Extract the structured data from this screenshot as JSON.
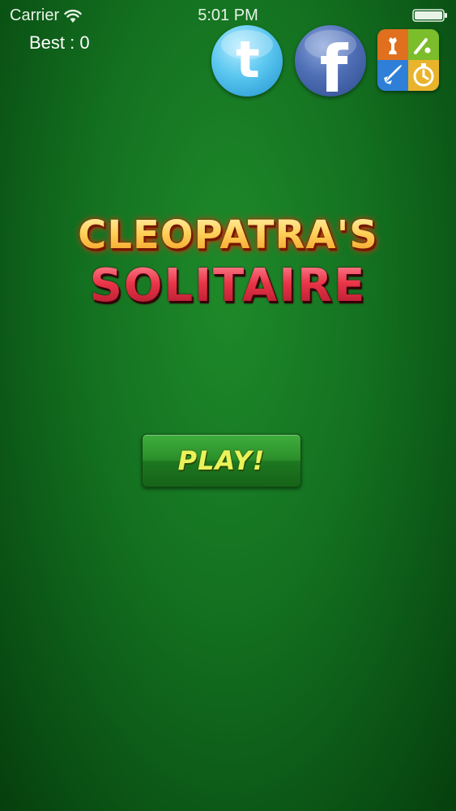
{
  "status_bar": {
    "carrier": "Carrier",
    "time": "5:01 PM"
  },
  "score": {
    "best_label": "Best : 0"
  },
  "social": {
    "twitter_glyph": "t",
    "facebook_glyph": "f"
  },
  "title": {
    "line1": "CLEOPATRA'S",
    "line2": "SOLITAIRE"
  },
  "play_button": {
    "label": "PLAY!"
  },
  "icons": {
    "wifi": "wifi-icon",
    "battery": "battery-icon",
    "twitter": "twitter-icon",
    "facebook": "facebook-icon",
    "game_center": "game-center-icon"
  },
  "colors": {
    "background": "#137020",
    "title_gold": "#ffc74f",
    "title_red": "#e8354a",
    "play_text": "#e9f25a",
    "play_button": "#2b8f2a"
  }
}
